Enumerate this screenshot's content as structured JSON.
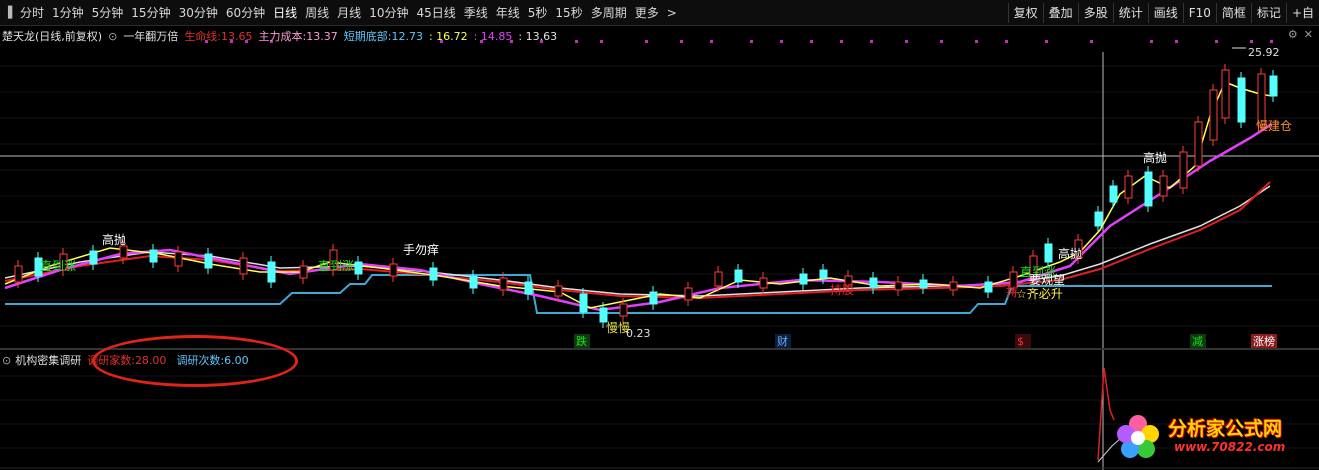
{
  "toolbar": {
    "periods": [
      {
        "label": "分时",
        "active": false
      },
      {
        "label": "1分钟",
        "active": false
      },
      {
        "label": "5分钟",
        "active": false
      },
      {
        "label": "15分钟",
        "active": false
      },
      {
        "label": "30分钟",
        "active": false
      },
      {
        "label": "60分钟",
        "active": false
      },
      {
        "label": "日线",
        "active": true
      },
      {
        "label": "周线",
        "active": false
      },
      {
        "label": "月线",
        "active": false
      },
      {
        "label": "10分钟",
        "active": false
      },
      {
        "label": "45日线",
        "active": false
      },
      {
        "label": "季线",
        "active": false
      },
      {
        "label": "年线",
        "active": false
      },
      {
        "label": "5秒",
        "active": false
      },
      {
        "label": "15秒",
        "active": false
      },
      {
        "label": "多周期",
        "active": false
      },
      {
        "label": "更多",
        "active": false
      }
    ],
    "more_chevron": ">",
    "right_buttons": [
      "复权",
      "叠加",
      "多股",
      "统计",
      "画线",
      "F10",
      "简框",
      "标记"
    ],
    "right_extra": "+自"
  },
  "main_chart": {
    "legend": {
      "stock": "楚天龙(日线,前复权)",
      "indicator": "一年翻万倍",
      "life_line_label": "生命线:",
      "life_line_value": "13.65",
      "main_cost_label": "主力成本:",
      "main_cost_value": "13.37",
      "short_bottom_label": "短期底部:",
      "short_bottom_value": "12.73",
      "value_4": ": 16.72",
      "value_5": ": 14.85",
      "value_6": ": 13.63"
    },
    "price_high_label": "25.92",
    "price_low_label": "0.23",
    "annotations": [
      {
        "text": "高抛",
        "color": "#ffffff"
      },
      {
        "text": "直到涨",
        "color": "#22dd22"
      },
      {
        "text": "直到涨",
        "color": "#22dd22"
      },
      {
        "text": "手勿痒",
        "color": "#ffffff"
      },
      {
        "text": "慢慢",
        "color": "#dddd44"
      },
      {
        "text": "持股",
        "color": "#dd2222"
      },
      {
        "text": "直到涨",
        "color": "#22dd22"
      },
      {
        "text": "高抛",
        "color": "#ffffff"
      },
      {
        "text": "要观望",
        "color": "#ffffff"
      },
      {
        "text": "持",
        "color": "#dd2222"
      },
      {
        "text": "☆齐必升",
        "color": "#ffee44"
      },
      {
        "text": "高抛",
        "color": "#ffffff"
      },
      {
        "text": "慢建仓",
        "color": "#ff8c2a"
      }
    ],
    "bottom_markers": [
      {
        "text": "跌",
        "color": "#22dd22",
        "bg": "#0b3a0b"
      },
      {
        "text": "财",
        "color": "#6aa8ff",
        "bg": "#0b1e3a"
      },
      {
        "text": "$",
        "color": "#ff3030",
        "bg": "#3a0b0b"
      },
      {
        "text": "减",
        "color": "#22dd22",
        "bg": "#0b3a0b"
      },
      {
        "text": "涨榜",
        "color": "#ffffff",
        "bg": "#8b1a1a"
      }
    ],
    "colors": {
      "up": "#ff3c3c",
      "down": "#54ffff",
      "yellow_line": "#ffff55",
      "magenta_line": "#e040fb",
      "red_line": "#e02020",
      "white_line": "#e0e0e0",
      "support_line": "#3fa9d6"
    }
  },
  "sub_chart": {
    "title": "机构密集调研",
    "count_label": "调研家数:",
    "count_value": "28.00",
    "times_label": "调研次数:",
    "times_value": "6.00"
  },
  "watermark": {
    "brand": "分析家公式网",
    "site": "www.70822.com"
  }
}
